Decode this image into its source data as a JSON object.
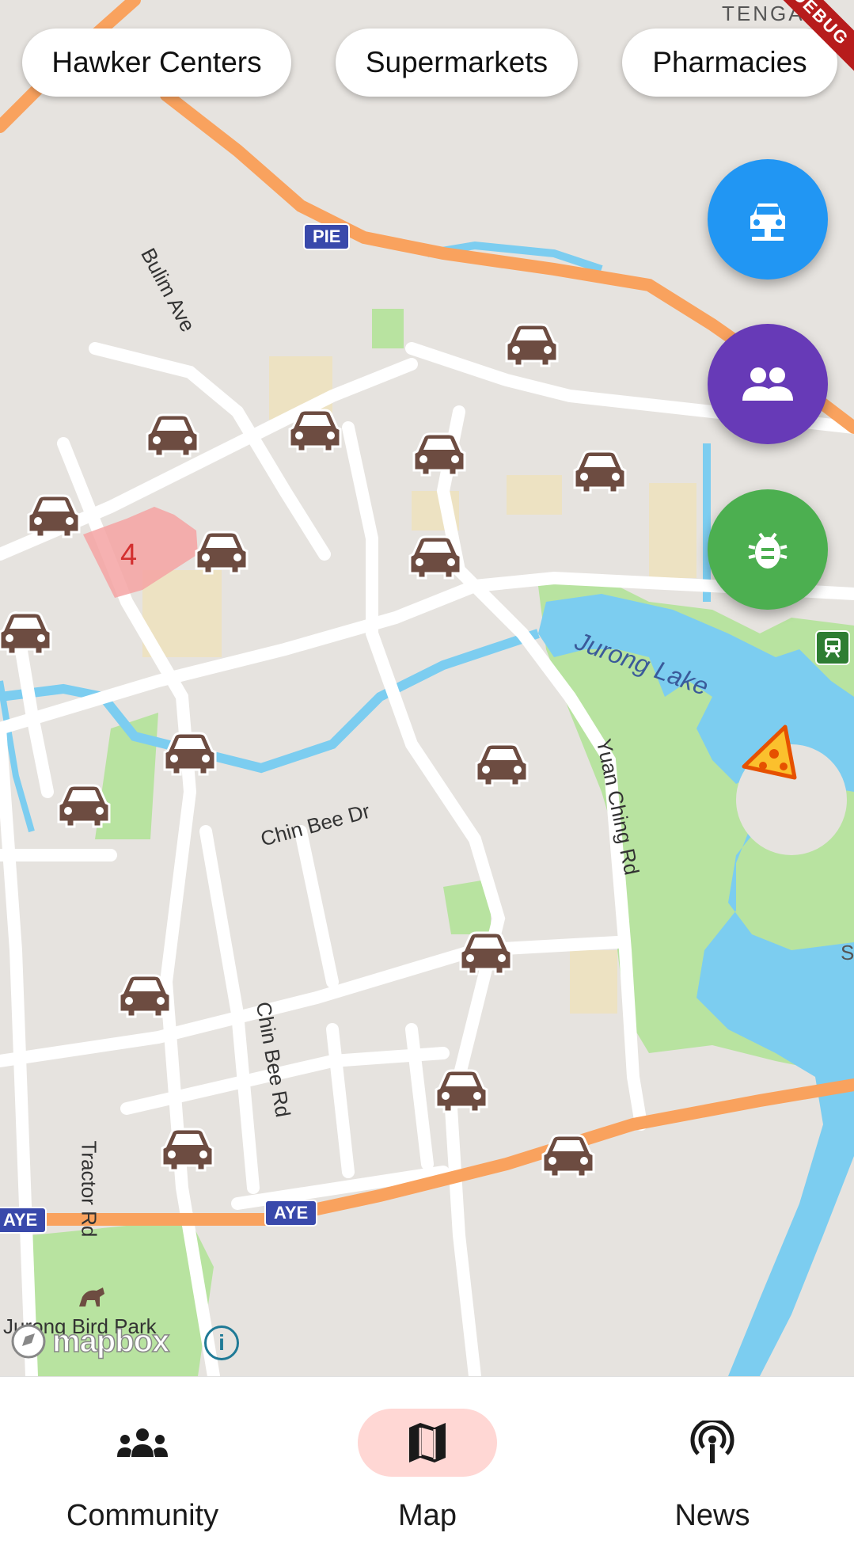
{
  "filters": {
    "hawker": "Hawker Centers",
    "supermarkets": "Supermarkets",
    "pharmacies": "Pharmacies"
  },
  "debug_banner": "DEBUG",
  "map": {
    "labels": {
      "bulim_ave": "Bulim Ave",
      "jurong_lake": "Jurong Lake",
      "yuan_ching_rd": "Yuan Ching Rd",
      "chin_bee_dr": "Chin Bee Dr",
      "chin_bee_rd": "Chin Bee Rd",
      "tractor_rd": "Tractor Rd",
      "jurong_bird_park": "Jurong Bird Park",
      "tengah_partial": "TENGAH",
      "s_partial": "S"
    },
    "shields": {
      "pie": "PIE",
      "aye": "AYE",
      "aye_left": "AYE"
    },
    "cluster_count": "4",
    "attribution": "mapbox",
    "info": "i"
  },
  "fabs": {
    "transport_icon": "car-transport-icon",
    "people_icon": "people-icon",
    "bug_icon": "bug-icon"
  },
  "colors": {
    "transport_fab": "#2196f3",
    "people_fab": "#673ab7",
    "bug_fab": "#4caf50",
    "car_marker": "#6d4c41",
    "nav_active_pill": "#ffd7d4",
    "expressway": "#f9a25e",
    "water": "#7ccdf0",
    "park": "#b8e3a0"
  },
  "nav": {
    "community": "Community",
    "map": "Map",
    "news": "News",
    "active": "map"
  }
}
